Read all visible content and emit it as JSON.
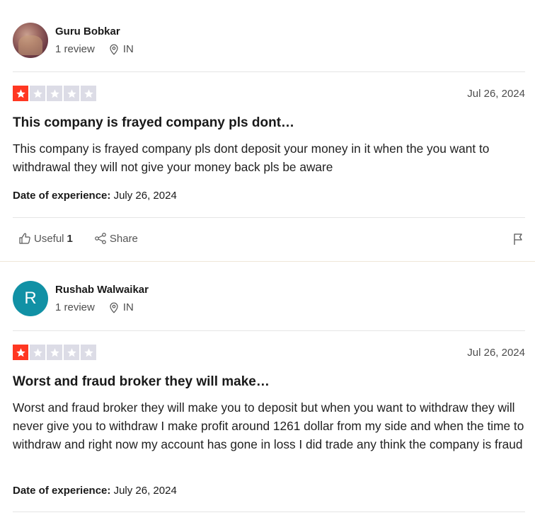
{
  "reviews": [
    {
      "reviewer": {
        "name": "Guru Bobkar",
        "reviews_count": "1 review",
        "country": "IN",
        "avatar_type": "photo"
      },
      "rating": 1,
      "date": "Jul 26, 2024",
      "title": "This company is frayed company pls dont…",
      "body": "This company is frayed company pls dont deposit your money in it when the you want to withdrawal they will not give your money back pls be aware",
      "experience_label": "Date of experience:",
      "experience_date": "July 26, 2024",
      "actions": {
        "useful_label": "Useful",
        "useful_count": "1",
        "share_label": "Share"
      }
    },
    {
      "reviewer": {
        "name": "Rushab Walwaikar",
        "initial": "R",
        "reviews_count": "1 review",
        "country": "IN",
        "avatar_type": "initial"
      },
      "rating": 1,
      "date": "Jul 26, 2024",
      "title": "Worst and fraud broker they will make…",
      "body": "Worst and fraud broker they will make you to deposit but when you want to withdraw they will never give you to withdraw I make profit around 1261 dollar from my side and when the time to withdraw and right now my account has gone in loss I did trade any think the company is fraud",
      "experience_label": "Date of experience:",
      "experience_date": "July 26, 2024"
    }
  ],
  "colors": {
    "star_on": "#ff3722",
    "star_off": "#dcdce6",
    "avatar_initial_bg": "#1191a5"
  },
  "icons": [
    "location-pin-icon",
    "star-icon",
    "thumbs-up-icon",
    "share-icon",
    "flag-icon"
  ]
}
